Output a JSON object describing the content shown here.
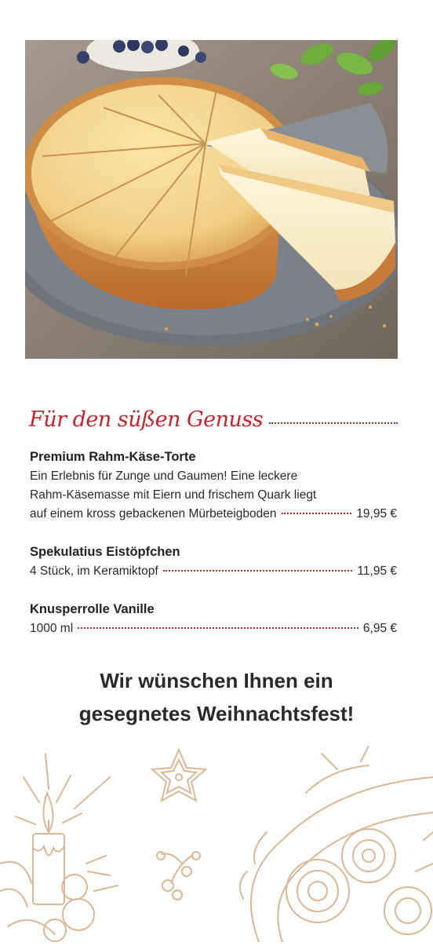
{
  "section": {
    "title": "Für den süßen Genuss"
  },
  "items": [
    {
      "name": "Premium Rahm-Käse-Torte",
      "description_lines": [
        "Ein Erlebnis für Zunge und Gaumen! Eine leckere",
        "Rahm-Käsemasse mit Eiern und frischem Quark liegt",
        "auf einem kross gebackenen Mürbeteigboden"
      ],
      "price": "19,95 €"
    },
    {
      "name": "Spekulatius Eistöpfchen",
      "description": "4 Stück, im Keramiktopf",
      "price": "11,95 €"
    },
    {
      "name": "Knusperrolle Vanille",
      "description": "1000 ml",
      "price": "6,95 €"
    }
  ],
  "greeting": {
    "line1": "Wir wünschen Ihnen ein",
    "line2": "gesegnetes Weihnachtsfest!"
  },
  "colors": {
    "accent": "#c0272d",
    "text": "#2a2a2a",
    "illustration": "#d9b896"
  }
}
